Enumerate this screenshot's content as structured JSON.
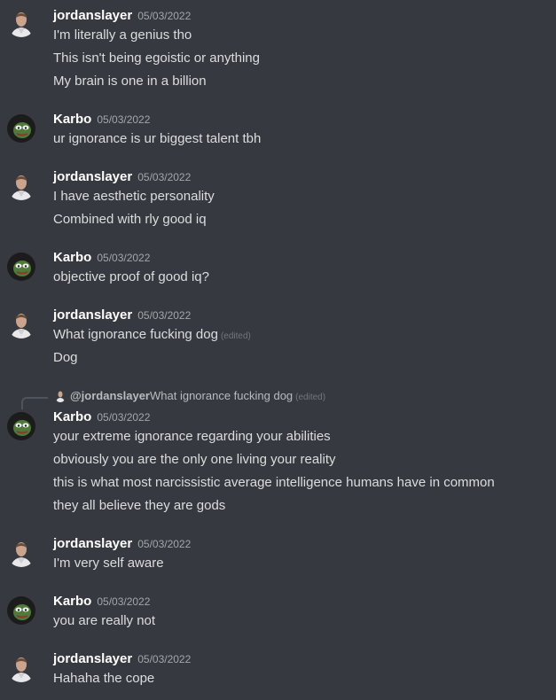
{
  "users": {
    "jordan": {
      "name": "jordanslayer",
      "avatar_icon": "man-portrait-icon"
    },
    "karbo": {
      "name": "Karbo",
      "avatar_icon": "pepe-hood-icon"
    }
  },
  "messages": [
    {
      "user": "jordanslayer",
      "time": "05/03/2022",
      "lines": [
        "I'm literally a genius tho",
        "This isn't being egoistic or anything",
        "My brain is one in a billion"
      ]
    },
    {
      "user": "Karbo",
      "time": "05/03/2022",
      "lines": [
        "ur ignorance is ur biggest talent tbh"
      ]
    },
    {
      "user": "jordanslayer",
      "time": "05/03/2022",
      "lines": [
        "I have aesthetic personality",
        "Combined with rly good iq"
      ]
    },
    {
      "user": "Karbo",
      "time": "05/03/2022",
      "lines": [
        "objective proof of good iq?"
      ]
    },
    {
      "user": "jordanslayer",
      "time": "05/03/2022",
      "lines": [
        "What ignorance fucking dog",
        "Dog"
      ],
      "edited_label": "(edited)"
    },
    {
      "user": "Karbo",
      "time": "05/03/2022",
      "lines": [
        "your extreme ignorance regarding your abilities",
        "obviously you are the only one living your reality",
        "this is what most narcissistic average intelligence humans have in common",
        "they all believe they are gods"
      ]
    },
    {
      "user": "jordanslayer",
      "time": "05/03/2022",
      "lines": [
        "I'm very self aware"
      ]
    },
    {
      "user": "Karbo",
      "time": "05/03/2022",
      "lines": [
        "you are really not"
      ]
    },
    {
      "user": "jordanslayer",
      "time": "05/03/2022",
      "lines": [
        "Hahaha the cope"
      ]
    }
  ],
  "reply": {
    "user": "@jordanslayer",
    "text": "What ignorance fucking dog",
    "edited_label": "(edited)"
  },
  "colors": {
    "background": "#36393f",
    "username": "#ffffff",
    "text": "#dcddde",
    "muted": "#a3a6aa"
  }
}
